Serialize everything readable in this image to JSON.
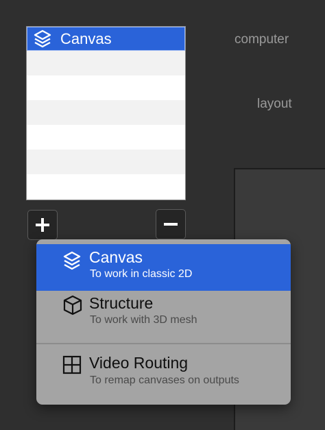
{
  "side_labels": {
    "computer": "computer",
    "layout": "layout"
  },
  "list": {
    "items": [
      "Canvas"
    ],
    "selected_index": 0
  },
  "buttons": {
    "add_label": "+",
    "remove_label": "−"
  },
  "menu": {
    "items": [
      {
        "label": "Canvas",
        "description": "To work in classic 2D",
        "icon": "layers-icon",
        "selected": true
      },
      {
        "label": "Structure",
        "description": "To work with 3D mesh",
        "icon": "cube-icon",
        "selected": false
      },
      {
        "label": "Video Routing",
        "description": "To remap canvases on outputs",
        "icon": "grid-icon",
        "selected": false
      }
    ]
  },
  "colors": {
    "background": "#2f2f2f",
    "accent": "#2a63d9",
    "menu_background": "#a4a4a4"
  }
}
